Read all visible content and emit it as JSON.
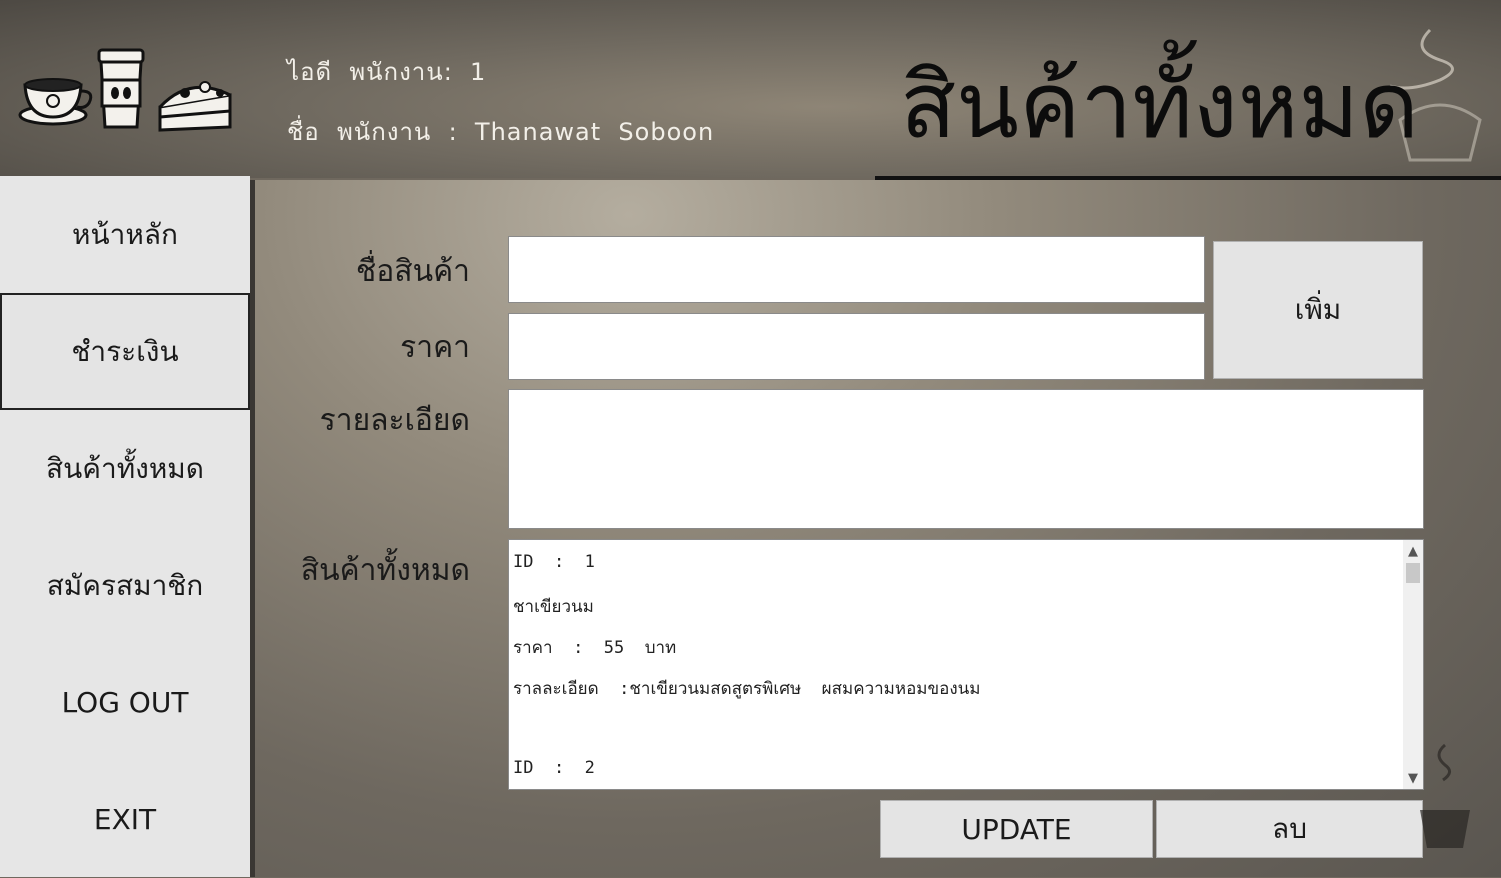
{
  "header": {
    "employee_id": "ไอดี  พนักงาน:  1",
    "employee_name": "ชื่อ  พนักงาน  :  Thanawat  Soboon",
    "page_title": "สินค้าทั้งหมด"
  },
  "sidebar": {
    "items": [
      {
        "label": "หน้าหลัก"
      },
      {
        "label": "ชำระเงิน"
      },
      {
        "label": "สินค้าทั้งหมด"
      },
      {
        "label": "สมัครสมาชิก"
      },
      {
        "label": "LOG   OUT"
      },
      {
        "label": "EXIT"
      }
    ]
  },
  "form": {
    "name_label": "ชื่อสินค้า",
    "name_value": "",
    "price_label": "ราคา",
    "price_value": "",
    "detail_label": "รายละเอียด",
    "detail_value": "",
    "all_label": "สินค้าทั้งหมด",
    "add_button": "เพิ่ม",
    "update_button": "UPDATE",
    "delete_button": "ลบ"
  },
  "product_list": {
    "lines": [
      "ID  :  1",
      "ชาเขียวนม",
      "ราคา  :  55  บาท",
      "ราลละเอียด  :ชาเขียวนมสดสูตรพิเศษ  ผสมความหอมของนม",
      "",
      "ID  :  2"
    ]
  },
  "colors": {
    "sidebar_bg": "#e6e6e6",
    "button_bg": "#e4e4e4",
    "header_text": "#f2efe8"
  }
}
